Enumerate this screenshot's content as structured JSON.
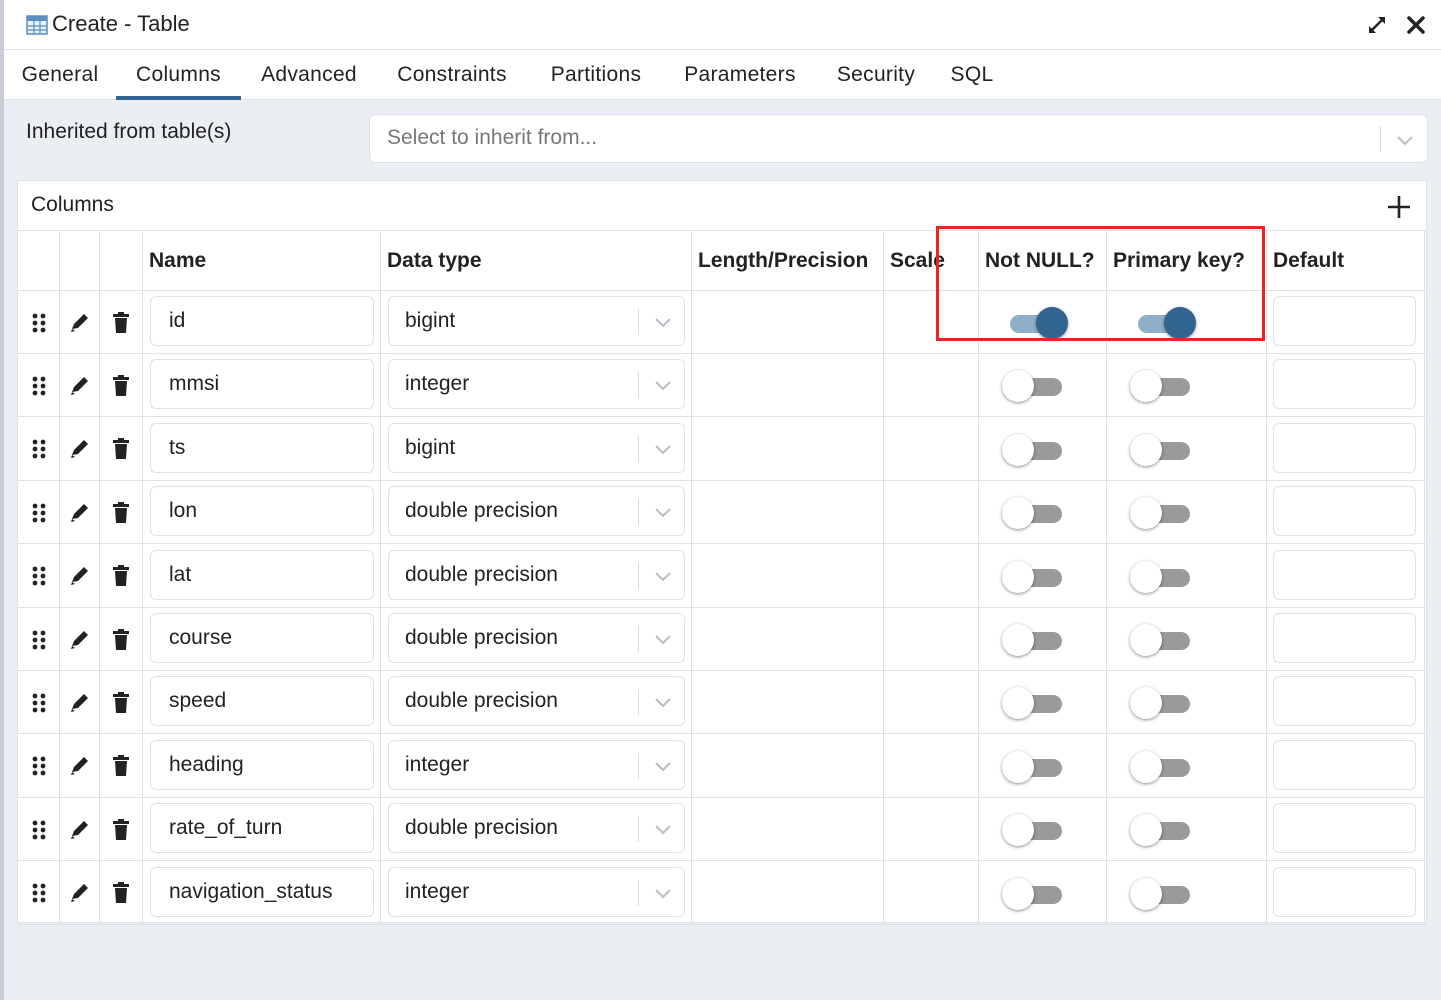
{
  "window": {
    "title": "Create - Table",
    "icons": [
      "table-icon",
      "expand-icon",
      "close-icon"
    ]
  },
  "tabs": [
    {
      "label": "General",
      "active": false
    },
    {
      "label": "Columns",
      "active": true
    },
    {
      "label": "Advanced",
      "active": false
    },
    {
      "label": "Constraints",
      "active": false
    },
    {
      "label": "Partitions",
      "active": false
    },
    {
      "label": "Parameters",
      "active": false
    },
    {
      "label": "Security",
      "active": false
    },
    {
      "label": "SQL",
      "active": false
    }
  ],
  "inherit": {
    "label": "Inherited from table(s)",
    "placeholder": "Select to inherit from..."
  },
  "columns_panel": {
    "title": "Columns",
    "headers": {
      "name": "Name",
      "data_type": "Data type",
      "length": "Length/Precision",
      "scale": "Scale",
      "not_null": "Not NULL?",
      "primary_key": "Primary key?",
      "default": "Default"
    },
    "rows": [
      {
        "name": "id",
        "type": "bigint",
        "not_null": true,
        "primary_key": true
      },
      {
        "name": "mmsi",
        "type": "integer",
        "not_null": false,
        "primary_key": false
      },
      {
        "name": "ts",
        "type": "bigint",
        "not_null": false,
        "primary_key": false
      },
      {
        "name": "lon",
        "type": "double precision",
        "not_null": false,
        "primary_key": false
      },
      {
        "name": "lat",
        "type": "double precision",
        "not_null": false,
        "primary_key": false
      },
      {
        "name": "course",
        "type": "double precision",
        "not_null": false,
        "primary_key": false
      },
      {
        "name": "speed",
        "type": "double precision",
        "not_null": false,
        "primary_key": false
      },
      {
        "name": "heading",
        "type": "integer",
        "not_null": false,
        "primary_key": false
      },
      {
        "name": "rate_of_turn",
        "type": "double precision",
        "not_null": false,
        "primary_key": false
      },
      {
        "name": "navigation_status",
        "type": "integer",
        "not_null": false,
        "primary_key": false
      }
    ]
  },
  "colors": {
    "accent": "#326690",
    "toggle_on_track": "#8fb0c8",
    "toggle_off_track": "#9a9a9a",
    "highlight": "#ee2222"
  }
}
